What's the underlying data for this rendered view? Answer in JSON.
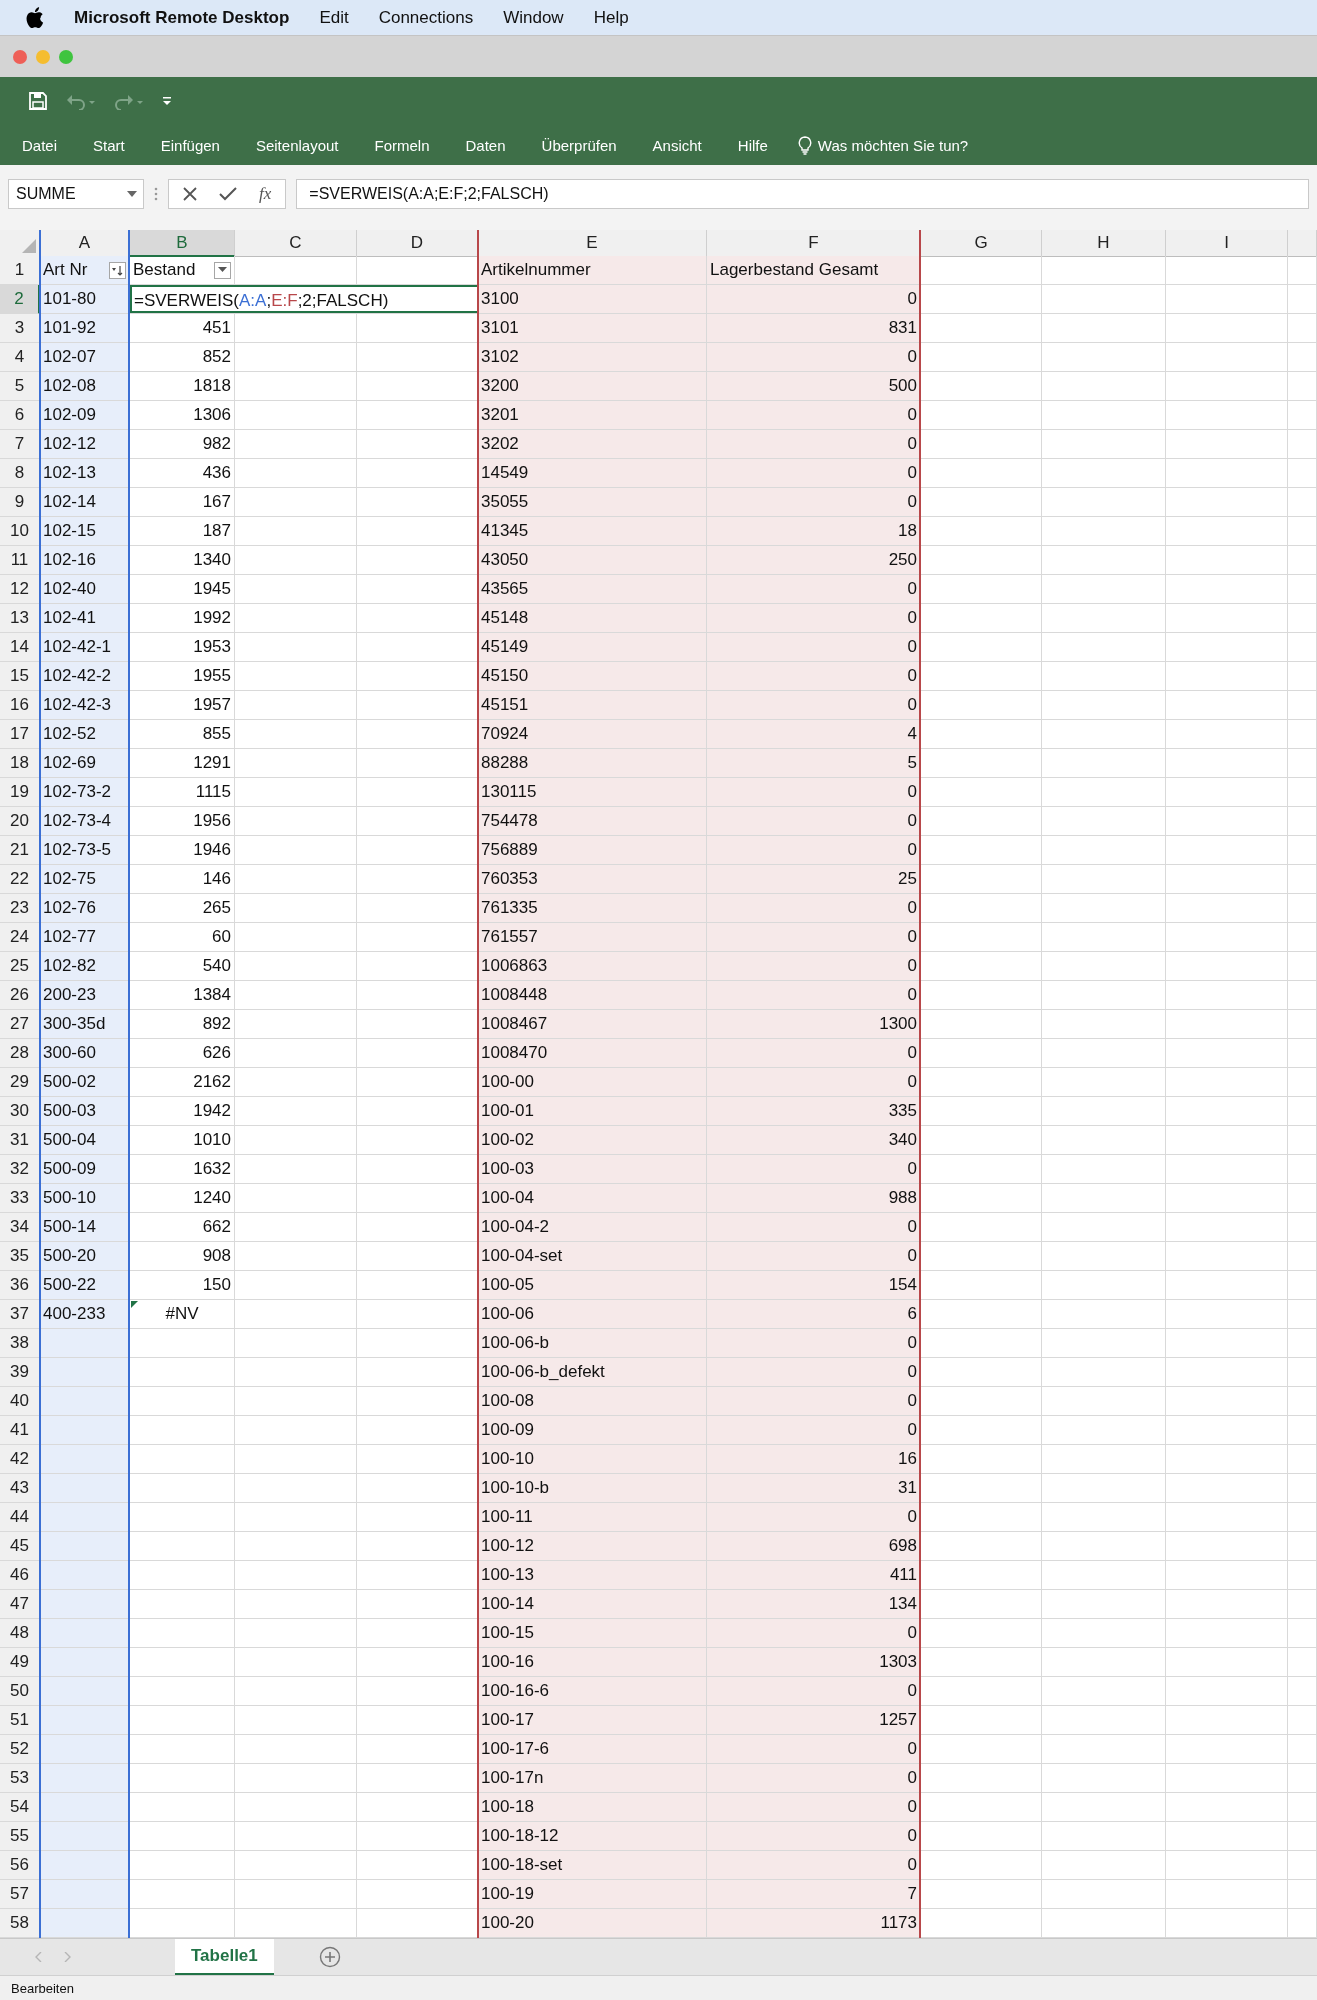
{
  "menu_bar": {
    "app_name": "Microsoft Remote Desktop",
    "items": [
      "Edit",
      "Connections",
      "Window",
      "Help"
    ]
  },
  "ribbon": {
    "tabs": [
      "Datei",
      "Start",
      "Einfügen",
      "Seitenlayout",
      "Formeln",
      "Daten",
      "Überprüfen",
      "Ansicht",
      "Hilfe"
    ],
    "tell_me": "Was möchten Sie tun?"
  },
  "formula_bar": {
    "name_box": "SUMME",
    "function_label": "fx",
    "formula": "=SVERWEIS(A:A;E:F;2;FALSCH)"
  },
  "columns": [
    {
      "label": "A",
      "selected": false,
      "color": "#3b6fd4"
    },
    {
      "label": "B",
      "selected": true,
      "numeric": true
    },
    {
      "label": "C",
      "selected": false
    },
    {
      "label": "D",
      "selected": false
    },
    {
      "label": "E",
      "selected": false,
      "color": "#b8474a"
    },
    {
      "label": "F",
      "selected": false,
      "numeric": true,
      "color": "#b8474a"
    },
    {
      "label": "G",
      "selected": false
    },
    {
      "label": "H",
      "selected": false
    },
    {
      "label": "I",
      "selected": false
    }
  ],
  "header_row": {
    "number": "1",
    "selected": false,
    "a": "Art Nr",
    "a_filter": {
      "kind": "sorted"
    },
    "b": "Bestand",
    "b_filter": {
      "kind": "dropdown"
    },
    "e": "Artikelnummer",
    "f": "Lagerbestand Gesamt"
  },
  "rows": [
    {
      "number": "2",
      "selected": true,
      "a": "101-80",
      "b_editing": [
        {
          "text": "=SVERWEIS("
        },
        {
          "text": "A:A",
          "color": "#3b6fd4"
        },
        {
          "text": ";"
        },
        {
          "text": "E:F",
          "color": "#b8474a"
        },
        {
          "text": ";2;FALSCH)"
        }
      ],
      "e": "3100",
      "f": "0"
    },
    {
      "number": "3",
      "selected": false,
      "a": "101-92",
      "b": "451",
      "e": "3101",
      "f": "831"
    },
    {
      "number": "4",
      "selected": false,
      "a": "102-07",
      "b": "852",
      "e": "3102",
      "f": "0"
    },
    {
      "number": "5",
      "selected": false,
      "a": "102-08",
      "b": "1818",
      "e": "3200",
      "f": "500"
    },
    {
      "number": "6",
      "selected": false,
      "a": "102-09",
      "b": "1306",
      "e": "3201",
      "f": "0"
    },
    {
      "number": "7",
      "selected": false,
      "a": "102-12",
      "b": "982",
      "e": "3202",
      "f": "0"
    },
    {
      "number": "8",
      "selected": false,
      "a": "102-13",
      "b": "436",
      "e": "14549",
      "f": "0"
    },
    {
      "number": "9",
      "selected": false,
      "a": "102-14",
      "b": "167",
      "e": "35055",
      "f": "0"
    },
    {
      "number": "10",
      "selected": false,
      "a": "102-15",
      "b": "187",
      "e": "41345",
      "f": "18"
    },
    {
      "number": "11",
      "selected": false,
      "a": "102-16",
      "b": "1340",
      "e": "43050",
      "f": "250"
    },
    {
      "number": "12",
      "selected": false,
      "a": "102-40",
      "b": "1945",
      "e": "43565",
      "f": "0"
    },
    {
      "number": "13",
      "selected": false,
      "a": "102-41",
      "b": "1992",
      "e": "45148",
      "f": "0"
    },
    {
      "number": "14",
      "selected": false,
      "a": "102-42-1",
      "b": "1953",
      "e": "45149",
      "f": "0"
    },
    {
      "number": "15",
      "selected": false,
      "a": "102-42-2",
      "b": "1955",
      "e": "45150",
      "f": "0"
    },
    {
      "number": "16",
      "selected": false,
      "a": "102-42-3",
      "b": "1957",
      "e": "45151",
      "f": "0"
    },
    {
      "number": "17",
      "selected": false,
      "a": "102-52",
      "b": "855",
      "e": "70924",
      "f": "4"
    },
    {
      "number": "18",
      "selected": false,
      "a": "102-69",
      "b": "1291",
      "e": "88288",
      "f": "5"
    },
    {
      "number": "19",
      "selected": false,
      "a": "102-73-2",
      "b": "1115",
      "e": "130115",
      "f": "0"
    },
    {
      "number": "20",
      "selected": false,
      "a": "102-73-4",
      "b": "1956",
      "e": "754478",
      "f": "0"
    },
    {
      "number": "21",
      "selected": false,
      "a": "102-73-5",
      "b": "1946",
      "e": "756889",
      "f": "0"
    },
    {
      "number": "22",
      "selected": false,
      "a": "102-75",
      "b": "146",
      "e": "760353",
      "f": "25"
    },
    {
      "number": "23",
      "selected": false,
      "a": "102-76",
      "b": "265",
      "e": "761335",
      "f": "0"
    },
    {
      "number": "24",
      "selected": false,
      "a": "102-77",
      "b": "60",
      "e": "761557",
      "f": "0"
    },
    {
      "number": "25",
      "selected": false,
      "a": "102-82",
      "b": "540",
      "e": "1006863",
      "f": "0"
    },
    {
      "number": "26",
      "selected": false,
      "a": "200-23",
      "b": "1384",
      "e": "1008448",
      "f": "0"
    },
    {
      "number": "27",
      "selected": false,
      "a": "300-35d",
      "b": "892",
      "e": "1008467",
      "f": "1300"
    },
    {
      "number": "28",
      "selected": false,
      "a": "300-60",
      "b": "626",
      "e": "1008470",
      "f": "0"
    },
    {
      "number": "29",
      "selected": false,
      "a": "500-02",
      "b": "2162",
      "e": "100-00",
      "f": "0"
    },
    {
      "number": "30",
      "selected": false,
      "a": "500-03",
      "b": "1942",
      "e": "100-01",
      "f": "335"
    },
    {
      "number": "31",
      "selected": false,
      "a": "500-04",
      "b": "1010",
      "e": "100-02",
      "f": "340"
    },
    {
      "number": "32",
      "selected": false,
      "a": "500-09",
      "b": "1632",
      "e": "100-03",
      "f": "0"
    },
    {
      "number": "33",
      "selected": false,
      "a": "500-10",
      "b": "1240",
      "e": "100-04",
      "f": "988"
    },
    {
      "number": "34",
      "selected": false,
      "a": "500-14",
      "b": "662",
      "e": "100-04-2",
      "f": "0"
    },
    {
      "number": "35",
      "selected": false,
      "a": "500-20",
      "b": "908",
      "e": "100-04-set",
      "f": "0"
    },
    {
      "number": "36",
      "selected": false,
      "a": "500-22",
      "b": "150",
      "e": "100-05",
      "f": "154"
    },
    {
      "number": "37",
      "selected": false,
      "a": "400-233",
      "b": "#NV",
      "b_error": true,
      "e": "100-06",
      "f": "6"
    },
    {
      "number": "38",
      "selected": false,
      "e": "100-06-b",
      "f": "0"
    },
    {
      "number": "39",
      "selected": false,
      "e": "100-06-b_defekt",
      "f": "0"
    },
    {
      "number": "40",
      "selected": false,
      "e": "100-08",
      "f": "0"
    },
    {
      "number": "41",
      "selected": false,
      "e": "100-09",
      "f": "0"
    },
    {
      "number": "42",
      "selected": false,
      "e": "100-10",
      "f": "16"
    },
    {
      "number": "43",
      "selected": false,
      "e": "100-10-b",
      "f": "31"
    },
    {
      "number": "44",
      "selected": false,
      "e": "100-11",
      "f": "0"
    },
    {
      "number": "45",
      "selected": false,
      "e": "100-12",
      "f": "698"
    },
    {
      "number": "46",
      "selected": false,
      "e": "100-13",
      "f": "411"
    },
    {
      "number": "47",
      "selected": false,
      "e": "100-14",
      "f": "134"
    },
    {
      "number": "48",
      "selected": false,
      "e": "100-15",
      "f": "0"
    },
    {
      "number": "49",
      "selected": false,
      "e": "100-16",
      "f": "1303"
    },
    {
      "number": "50",
      "selected": false,
      "e": "100-16-6",
      "f": "0"
    },
    {
      "number": "51",
      "selected": false,
      "e": "100-17",
      "f": "1257"
    },
    {
      "number": "52",
      "selected": false,
      "e": "100-17-6",
      "f": "0"
    },
    {
      "number": "53",
      "selected": false,
      "e": "100-17n",
      "f": "0"
    },
    {
      "number": "54",
      "selected": false,
      "e": "100-18",
      "f": "0"
    },
    {
      "number": "55",
      "selected": false,
      "e": "100-18-12",
      "f": "0"
    },
    {
      "number": "56",
      "selected": false,
      "e": "100-18-set",
      "f": "0"
    },
    {
      "number": "57",
      "selected": false,
      "e": "100-19",
      "f": "7"
    },
    {
      "number": "58",
      "selected": false,
      "e": "100-20",
      "f": "1173"
    }
  ],
  "sheet_tabs": [
    {
      "label": "Tabelle1",
      "selected": true
    }
  ],
  "status_bar": "Bearbeiten"
}
